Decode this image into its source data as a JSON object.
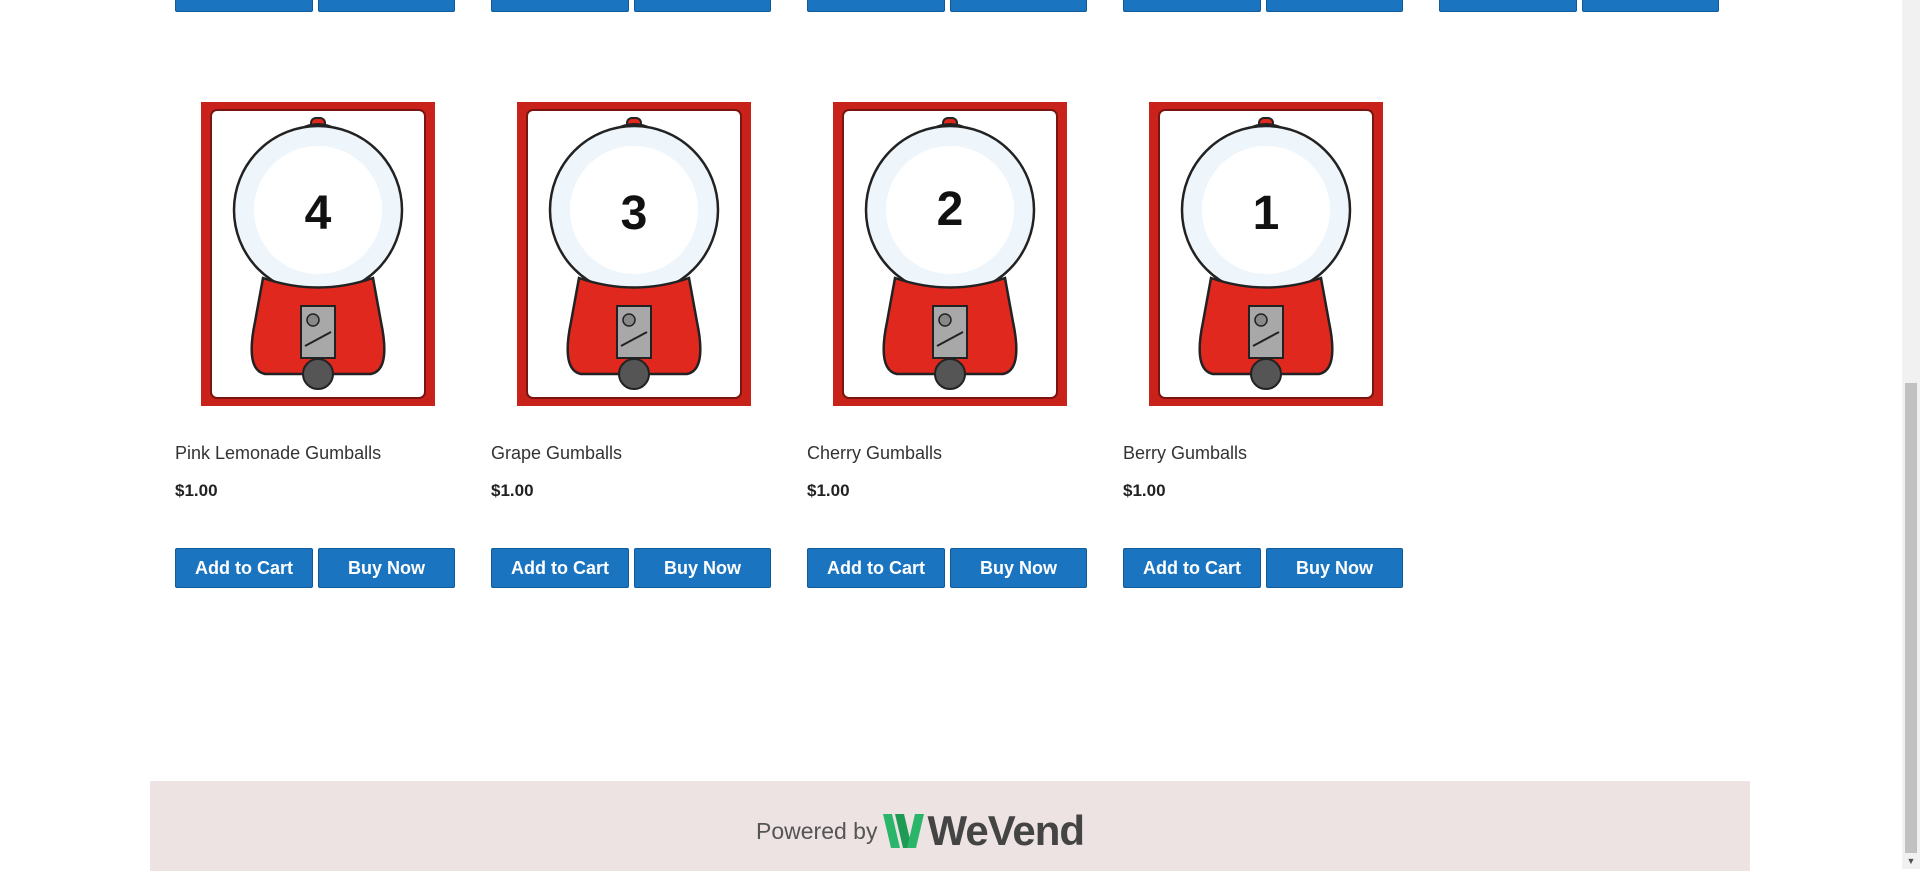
{
  "products": [
    {
      "name": "Pink Lemonade Gumballs",
      "price": "$1.00",
      "number": "4",
      "add_to_cart": "Add to Cart",
      "buy_now": "Buy Now"
    },
    {
      "name": "Grape Gumballs",
      "price": "$1.00",
      "number": "3",
      "add_to_cart": "Add to Cart",
      "buy_now": "Buy Now"
    },
    {
      "name": "Cherry Gumballs",
      "price": "$1.00",
      "number": "2",
      "add_to_cart": "Add to Cart",
      "buy_now": "Buy Now"
    },
    {
      "name": "Berry Gumballs",
      "price": "$1.00",
      "number": "1",
      "add_to_cart": "Add to Cart",
      "buy_now": "Buy Now"
    }
  ],
  "footer": {
    "powered_by": "Powered by",
    "brand": "WeVend"
  },
  "colors": {
    "button": "#1a74c0",
    "card_border_red": "#c8221a",
    "footer_bg": "#ede3e2",
    "logo_green": "#2bb56a"
  },
  "icons": {
    "product_image": "gumball-machine-card",
    "logo": "wevend-logo-icon",
    "scroll_down": "scroll-down-arrow-icon"
  }
}
